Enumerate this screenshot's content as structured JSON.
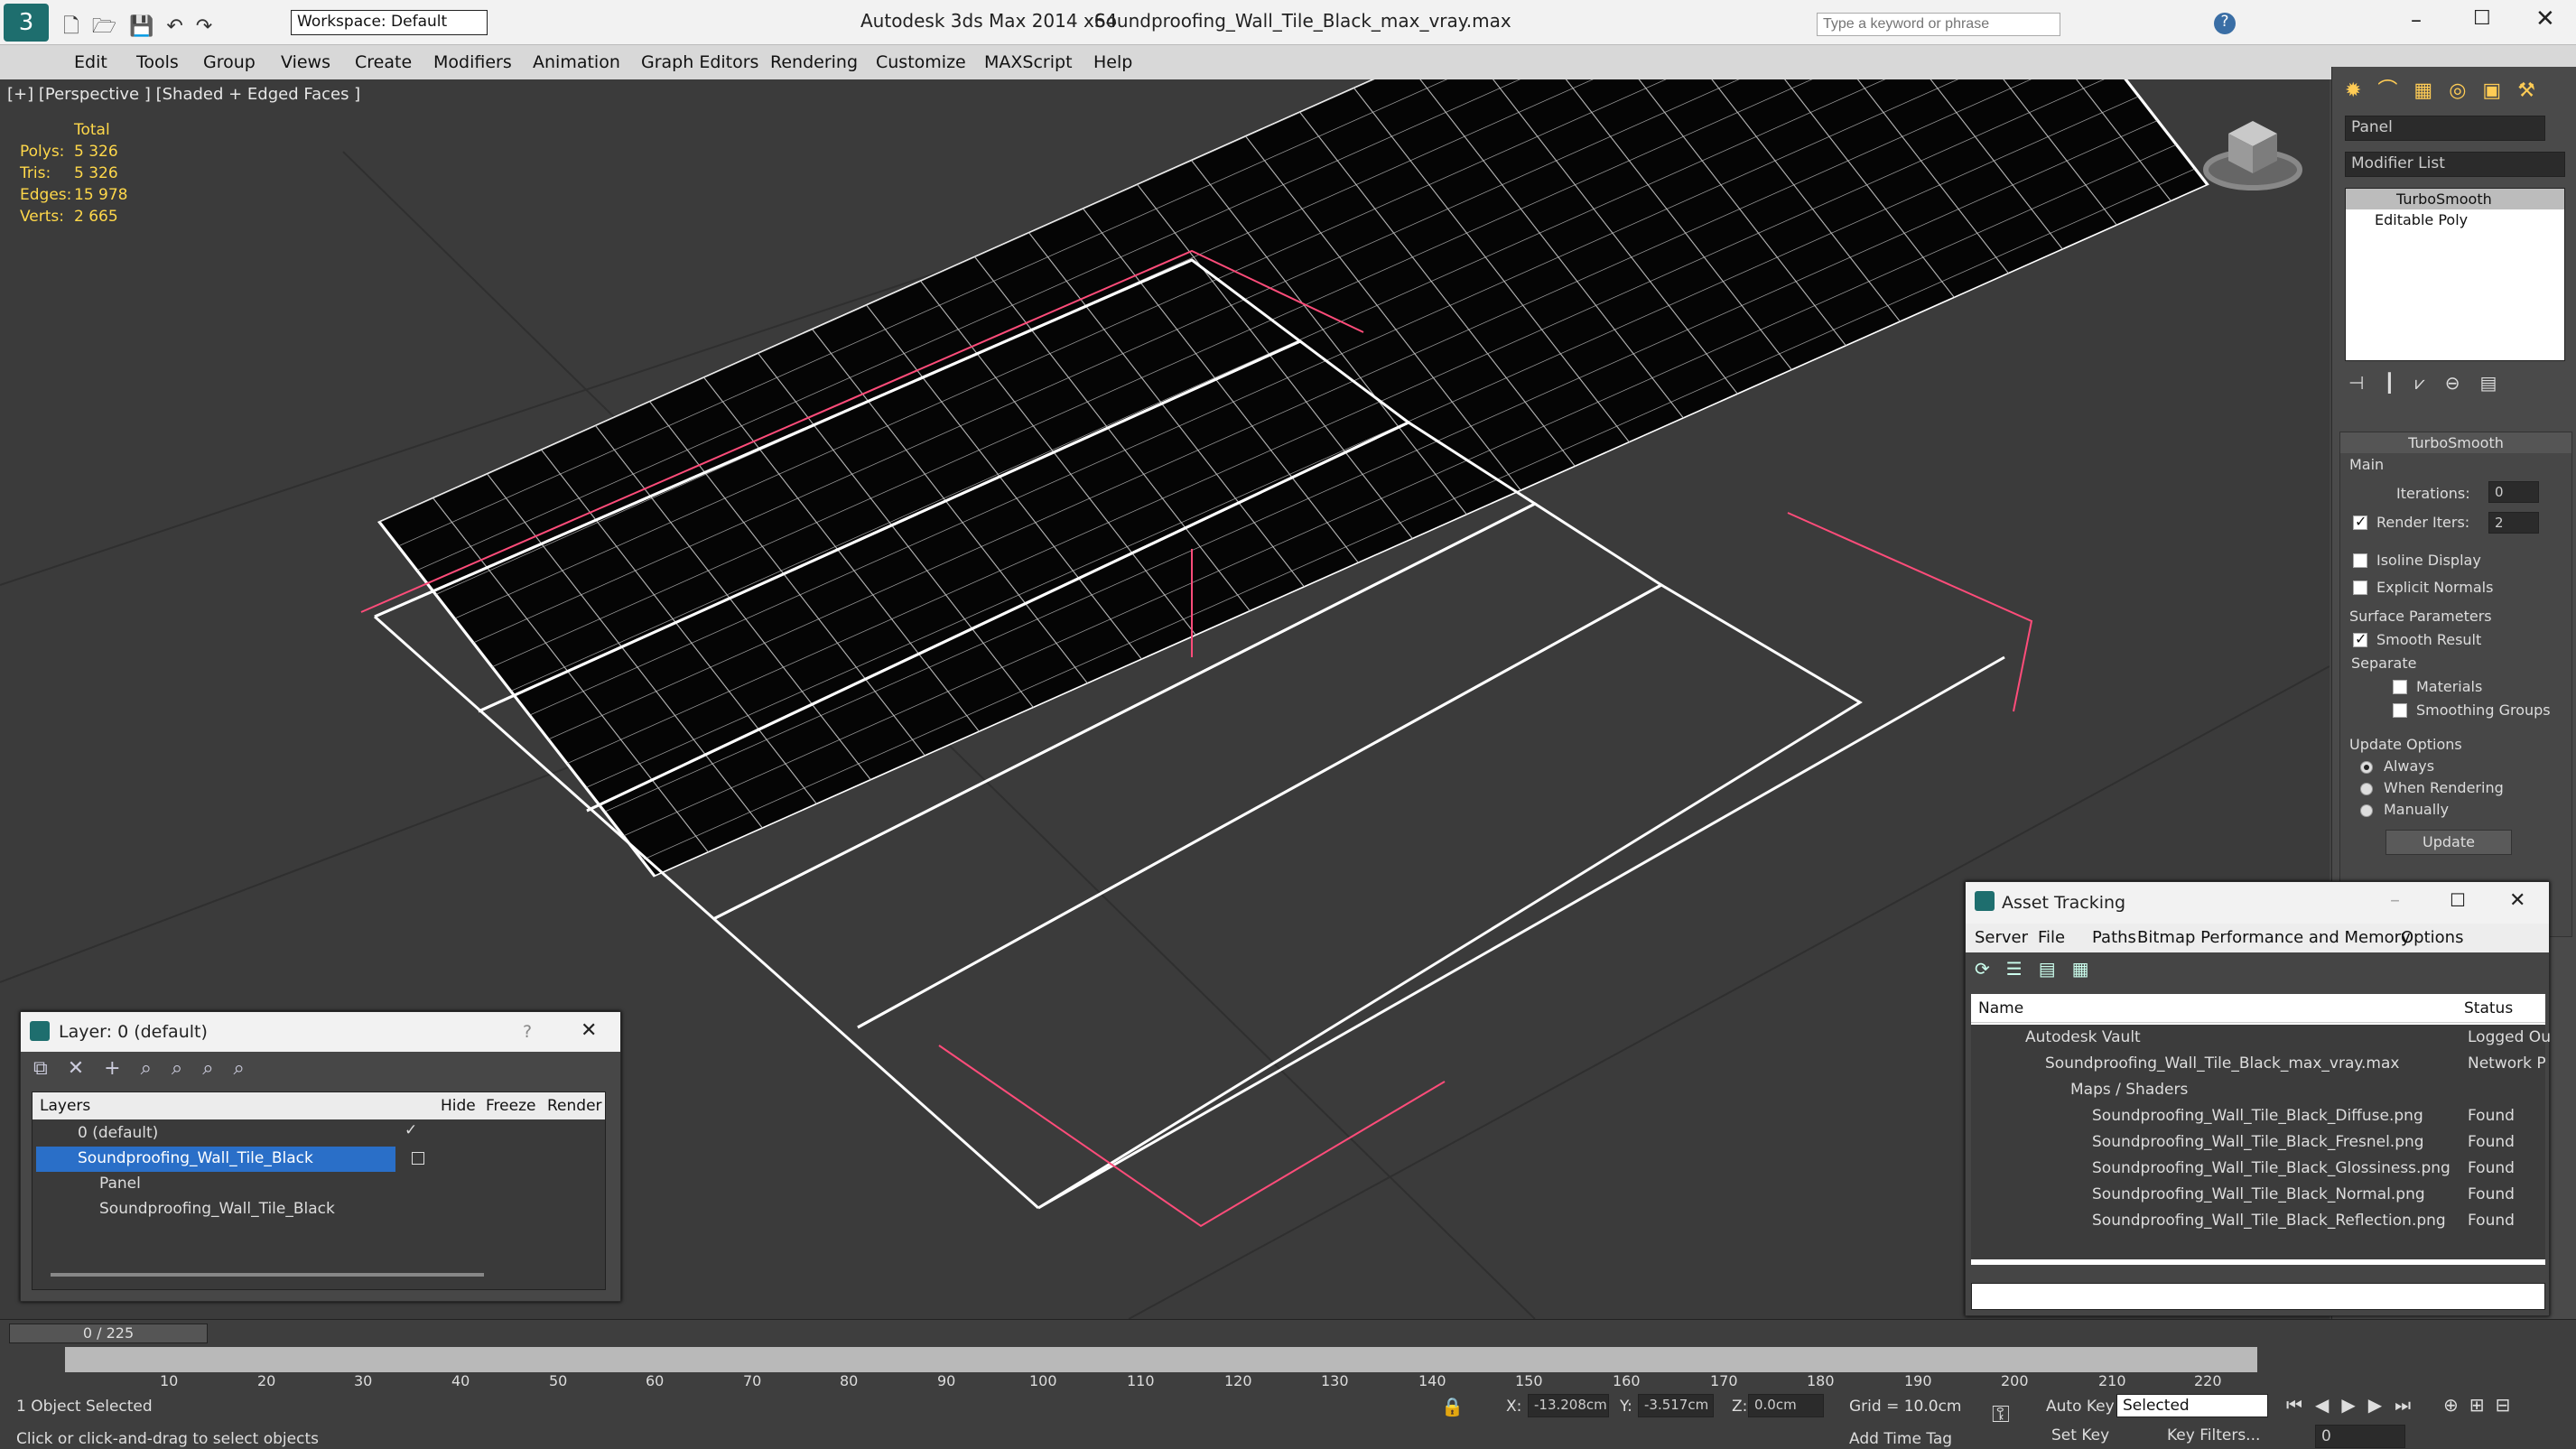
{
  "window": {
    "app_title": "Autodesk 3ds Max  2014 x64",
    "file_title": "Soundproofing_Wall_Tile_Black_max_vray.max",
    "workspace": "Workspace: Default",
    "search_placeholder": "Type a keyword or phrase"
  },
  "menu": [
    "Edit",
    "Tools",
    "Group",
    "Views",
    "Create",
    "Modifiers",
    "Animation",
    "Graph Editors",
    "Rendering",
    "Customize",
    "MAXScript",
    "Help"
  ],
  "viewport": {
    "label": "[+] [Perspective ] [Shaded + Edged Faces ]",
    "stats_header": "Total",
    "stats": [
      {
        "k": "Polys:",
        "v": "5 326"
      },
      {
        "k": "Tris:",
        "v": "5 326"
      },
      {
        "k": "Edges:",
        "v": "15 978"
      },
      {
        "k": "Verts:",
        "v": "2 665"
      }
    ]
  },
  "cmd": {
    "name": "Panel",
    "modifier_list": "Modifier List",
    "stack": [
      "TurboSmooth",
      "Editable Poly"
    ],
    "rollout": "TurboSmooth",
    "main": "Main",
    "iterations_label": "Iterations:",
    "iterations": "0",
    "render_iters_label": "Render Iters:",
    "render_iters": "2",
    "isoline": "Isoline Display",
    "explicit": "Explicit Normals",
    "surface": "Surface Parameters",
    "smooth_result": "Smooth Result",
    "separate": "Separate",
    "materials": "Materials",
    "smoothing_groups": "Smoothing Groups",
    "update_options": "Update Options",
    "always": "Always",
    "when_rendering": "When Rendering",
    "manually": "Manually",
    "update": "Update"
  },
  "layer": {
    "title": "Layer: 0 (default)",
    "help": "?",
    "cols": [
      "Layers",
      "Hide",
      "Freeze",
      "Render"
    ],
    "rows": [
      "0 (default)",
      "Soundproofing_Wall_Tile_Black",
      "Panel",
      "Soundproofing_Wall_Tile_Black"
    ]
  },
  "asset": {
    "title": "Asset Tracking",
    "menu": [
      "Server",
      "File",
      "Paths",
      "Bitmap Performance and Memory",
      "Options"
    ],
    "cols": [
      "Name",
      "Status"
    ],
    "rows": [
      {
        "n": "Autodesk Vault",
        "s": "Logged Ou"
      },
      {
        "n": "Soundproofing_Wall_Tile_Black_max_vray.max",
        "s": "Network P"
      },
      {
        "n": "Maps / Shaders",
        "s": ""
      },
      {
        "n": "Soundproofing_Wall_Tile_Black_Diffuse.png",
        "s": "Found"
      },
      {
        "n": "Soundproofing_Wall_Tile_Black_Fresnel.png",
        "s": "Found"
      },
      {
        "n": "Soundproofing_Wall_Tile_Black_Glossiness.png",
        "s": "Found"
      },
      {
        "n": "Soundproofing_Wall_Tile_Black_Normal.png",
        "s": "Found"
      },
      {
        "n": "Soundproofing_Wall_Tile_Black_Reflection.png",
        "s": "Found"
      }
    ]
  },
  "timeline": {
    "frame": "0 / 225",
    "ticks": [
      "10",
      "20",
      "30",
      "40",
      "50",
      "60",
      "70",
      "80",
      "90",
      "100",
      "110",
      "120",
      "130",
      "140",
      "150",
      "160",
      "170",
      "180",
      "190",
      "200",
      "210",
      "220"
    ]
  },
  "status": {
    "selected": "1 Object Selected",
    "prompt": "Click or click-and-drag to select objects",
    "x_label": "X:",
    "x": "-13.208cm",
    "y_label": "Y:",
    "y": "-3.517cm",
    "z_label": "Z:",
    "z": "0.0cm",
    "grid": "Grid = 10.0cm",
    "auto_key": "Auto Key",
    "selected_dd": "Selected",
    "set_key": "Set Key",
    "key_filters": "Key Filters...",
    "add_time_tag": "Add Time Tag",
    "frame_field": "0"
  }
}
